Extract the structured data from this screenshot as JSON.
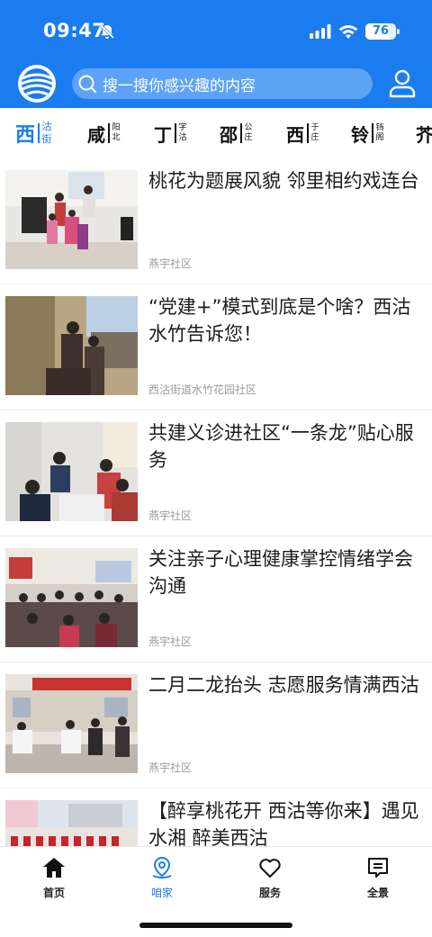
{
  "status_bar": {
    "time": "09:47",
    "battery": "76"
  },
  "search": {
    "placeholder": "搜一搜你感兴趣的内容"
  },
  "tabs": [
    {
      "big": "西",
      "small_top": "沽",
      "small_bottom": "街"
    },
    {
      "big": "咸",
      "small_top": "阳",
      "small_bottom": "北"
    },
    {
      "big": "丁",
      "small_top": "字",
      "small_bottom": "沽"
    },
    {
      "big": "邵",
      "small_top": "公",
      "small_bottom": "庄"
    },
    {
      "big": "西",
      "small_top": "于",
      "small_bottom": "庄"
    },
    {
      "big": "铃",
      "small_top": "铛",
      "small_bottom": "阁"
    },
    {
      "big": "芥",
      "small_top": "",
      "small_bottom": ""
    }
  ],
  "feed": [
    {
      "title": "桃花为题展风貌 邻里相约戏连台",
      "source": "燕宇社区"
    },
    {
      "title": "“党建+”模式到底是个啥？西沽水竹告诉您！",
      "source": "西沽街道水竹花园社区"
    },
    {
      "title": "共建义诊进社区“一条龙”贴心服务",
      "source": "燕宇社区"
    },
    {
      "title": "关注亲子心理健康掌控情绪学会沟通",
      "source": "燕宇社区"
    },
    {
      "title": "二月二龙抬头 志愿服务情满西沽",
      "source": "燕宇社区"
    },
    {
      "title": "【醉享桃花开 西沽等你来】遇见水湘 醉美西沽",
      "source": ""
    }
  ],
  "bottom_nav": [
    {
      "label": "首页",
      "icon": "home-icon"
    },
    {
      "label": "咱家",
      "icon": "location-pin-icon"
    },
    {
      "label": "服务",
      "icon": "heart-icon"
    },
    {
      "label": "全景",
      "icon": "message-icon"
    }
  ],
  "colors": {
    "brand": "#1a7cef",
    "search_bg": "#5da3f5",
    "source_text": "#9a9a9a"
  }
}
